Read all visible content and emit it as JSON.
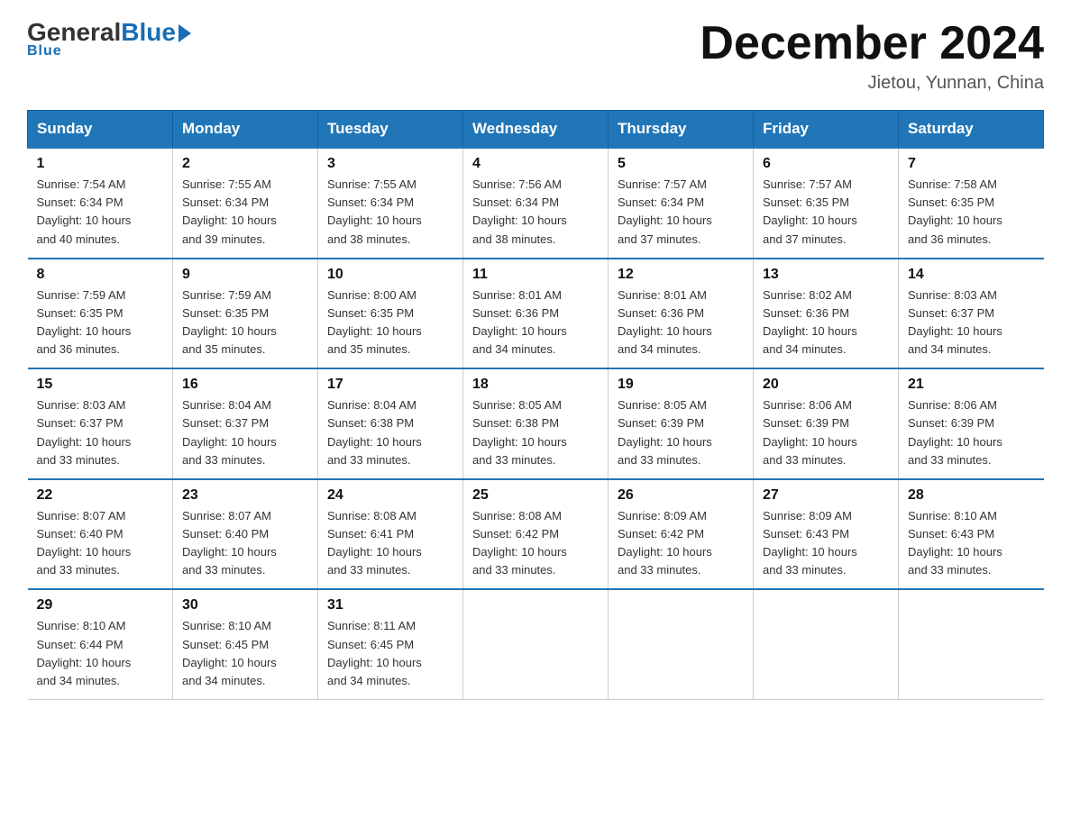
{
  "logo": {
    "general": "General",
    "blue": "Blue",
    "underline": "Blue"
  },
  "header": {
    "title": "December 2024",
    "location": "Jietou, Yunnan, China"
  },
  "days_of_week": [
    "Sunday",
    "Monday",
    "Tuesday",
    "Wednesday",
    "Thursday",
    "Friday",
    "Saturday"
  ],
  "weeks": [
    [
      {
        "day": "1",
        "info": "Sunrise: 7:54 AM\nSunset: 6:34 PM\nDaylight: 10 hours\nand 40 minutes."
      },
      {
        "day": "2",
        "info": "Sunrise: 7:55 AM\nSunset: 6:34 PM\nDaylight: 10 hours\nand 39 minutes."
      },
      {
        "day": "3",
        "info": "Sunrise: 7:55 AM\nSunset: 6:34 PM\nDaylight: 10 hours\nand 38 minutes."
      },
      {
        "day": "4",
        "info": "Sunrise: 7:56 AM\nSunset: 6:34 PM\nDaylight: 10 hours\nand 38 minutes."
      },
      {
        "day": "5",
        "info": "Sunrise: 7:57 AM\nSunset: 6:34 PM\nDaylight: 10 hours\nand 37 minutes."
      },
      {
        "day": "6",
        "info": "Sunrise: 7:57 AM\nSunset: 6:35 PM\nDaylight: 10 hours\nand 37 minutes."
      },
      {
        "day": "7",
        "info": "Sunrise: 7:58 AM\nSunset: 6:35 PM\nDaylight: 10 hours\nand 36 minutes."
      }
    ],
    [
      {
        "day": "8",
        "info": "Sunrise: 7:59 AM\nSunset: 6:35 PM\nDaylight: 10 hours\nand 36 minutes."
      },
      {
        "day": "9",
        "info": "Sunrise: 7:59 AM\nSunset: 6:35 PM\nDaylight: 10 hours\nand 35 minutes."
      },
      {
        "day": "10",
        "info": "Sunrise: 8:00 AM\nSunset: 6:35 PM\nDaylight: 10 hours\nand 35 minutes."
      },
      {
        "day": "11",
        "info": "Sunrise: 8:01 AM\nSunset: 6:36 PM\nDaylight: 10 hours\nand 34 minutes."
      },
      {
        "day": "12",
        "info": "Sunrise: 8:01 AM\nSunset: 6:36 PM\nDaylight: 10 hours\nand 34 minutes."
      },
      {
        "day": "13",
        "info": "Sunrise: 8:02 AM\nSunset: 6:36 PM\nDaylight: 10 hours\nand 34 minutes."
      },
      {
        "day": "14",
        "info": "Sunrise: 8:03 AM\nSunset: 6:37 PM\nDaylight: 10 hours\nand 34 minutes."
      }
    ],
    [
      {
        "day": "15",
        "info": "Sunrise: 8:03 AM\nSunset: 6:37 PM\nDaylight: 10 hours\nand 33 minutes."
      },
      {
        "day": "16",
        "info": "Sunrise: 8:04 AM\nSunset: 6:37 PM\nDaylight: 10 hours\nand 33 minutes."
      },
      {
        "day": "17",
        "info": "Sunrise: 8:04 AM\nSunset: 6:38 PM\nDaylight: 10 hours\nand 33 minutes."
      },
      {
        "day": "18",
        "info": "Sunrise: 8:05 AM\nSunset: 6:38 PM\nDaylight: 10 hours\nand 33 minutes."
      },
      {
        "day": "19",
        "info": "Sunrise: 8:05 AM\nSunset: 6:39 PM\nDaylight: 10 hours\nand 33 minutes."
      },
      {
        "day": "20",
        "info": "Sunrise: 8:06 AM\nSunset: 6:39 PM\nDaylight: 10 hours\nand 33 minutes."
      },
      {
        "day": "21",
        "info": "Sunrise: 8:06 AM\nSunset: 6:39 PM\nDaylight: 10 hours\nand 33 minutes."
      }
    ],
    [
      {
        "day": "22",
        "info": "Sunrise: 8:07 AM\nSunset: 6:40 PM\nDaylight: 10 hours\nand 33 minutes."
      },
      {
        "day": "23",
        "info": "Sunrise: 8:07 AM\nSunset: 6:40 PM\nDaylight: 10 hours\nand 33 minutes."
      },
      {
        "day": "24",
        "info": "Sunrise: 8:08 AM\nSunset: 6:41 PM\nDaylight: 10 hours\nand 33 minutes."
      },
      {
        "day": "25",
        "info": "Sunrise: 8:08 AM\nSunset: 6:42 PM\nDaylight: 10 hours\nand 33 minutes."
      },
      {
        "day": "26",
        "info": "Sunrise: 8:09 AM\nSunset: 6:42 PM\nDaylight: 10 hours\nand 33 minutes."
      },
      {
        "day": "27",
        "info": "Sunrise: 8:09 AM\nSunset: 6:43 PM\nDaylight: 10 hours\nand 33 minutes."
      },
      {
        "day": "28",
        "info": "Sunrise: 8:10 AM\nSunset: 6:43 PM\nDaylight: 10 hours\nand 33 minutes."
      }
    ],
    [
      {
        "day": "29",
        "info": "Sunrise: 8:10 AM\nSunset: 6:44 PM\nDaylight: 10 hours\nand 34 minutes."
      },
      {
        "day": "30",
        "info": "Sunrise: 8:10 AM\nSunset: 6:45 PM\nDaylight: 10 hours\nand 34 minutes."
      },
      {
        "day": "31",
        "info": "Sunrise: 8:11 AM\nSunset: 6:45 PM\nDaylight: 10 hours\nand 34 minutes."
      },
      {
        "day": "",
        "info": ""
      },
      {
        "day": "",
        "info": ""
      },
      {
        "day": "",
        "info": ""
      },
      {
        "day": "",
        "info": ""
      }
    ]
  ]
}
